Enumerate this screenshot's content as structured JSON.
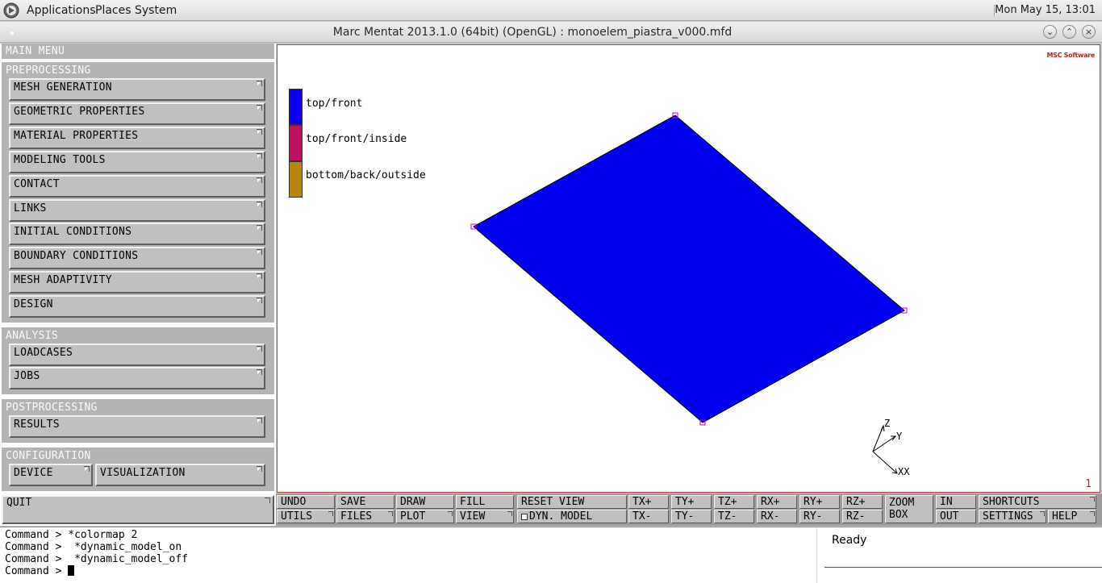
{
  "top_panel": {
    "menus": [
      "Applications",
      "Places",
      "System"
    ],
    "clock": "Mon May 15, 13:01",
    "logo_icon": "gnome-foot-icon"
  },
  "window": {
    "title": "Marc Mentat 2013.1.0 (64bit) (OpenGL) : monoelem_piastra_v000.mfd",
    "controls": [
      "minimize-icon",
      "maximize-icon",
      "close-icon"
    ]
  },
  "main_menu": {
    "title": "MAIN MENU",
    "preprocessing": {
      "title": "PREPROCESSING",
      "items": [
        "MESH GENERATION",
        "GEOMETRIC PROPERTIES",
        "MATERIAL PROPERTIES",
        "MODELING TOOLS",
        "CONTACT",
        "LINKS",
        "INITIAL CONDITIONS",
        "BOUNDARY CONDITIONS",
        "MESH ADAPTIVITY",
        "DESIGN"
      ]
    },
    "analysis": {
      "title": "ANALYSIS",
      "items": [
        "LOADCASES",
        "JOBS"
      ]
    },
    "postprocessing": {
      "title": "POSTPROCESSING",
      "items": [
        "RESULTS"
      ]
    },
    "configuration": {
      "title": "CONFIGURATION",
      "items": [
        "DEVICE",
        "VISUALIZATION"
      ]
    },
    "quit": "QUIT"
  },
  "graphics": {
    "legend": [
      {
        "label": "top/front",
        "color": "#0b00f0"
      },
      {
        "label": "top/front/inside",
        "color": "#c01060"
      },
      {
        "label": "bottom/back/outside",
        "color": "#b8860b"
      }
    ],
    "element_color": "#0000ee",
    "node_color": "#d000d0",
    "axes": {
      "z": "Z",
      "y": "Y",
      "x": "XX"
    },
    "view_number": "1",
    "logo": "MSC Software"
  },
  "toolbar": {
    "row1": [
      "UNDO",
      "SAVE",
      "DRAW",
      "FILL",
      "RESET VIEW",
      "TX+",
      "TY+",
      "TZ+",
      "RX+",
      "RY+",
      "RZ+"
    ],
    "row2": [
      "UTILS",
      "FILES",
      "PLOT",
      "VIEW",
      "DYN. MODEL",
      "TX-",
      "TY-",
      "TZ-",
      "RX-",
      "RY-",
      "RZ-"
    ],
    "zoom_box": "ZOOM BOX",
    "zoom_in": "IN",
    "zoom_out": "OUT",
    "shortcuts": "SHORTCUTS",
    "settings": "SETTINGS",
    "help": "HELP"
  },
  "command": {
    "history": [
      "Command > *colormap 2",
      "Command >  *dynamic_model_on",
      "Command >  *dynamic_model_off"
    ],
    "prompt": "Command > ",
    "status": "Ready"
  }
}
